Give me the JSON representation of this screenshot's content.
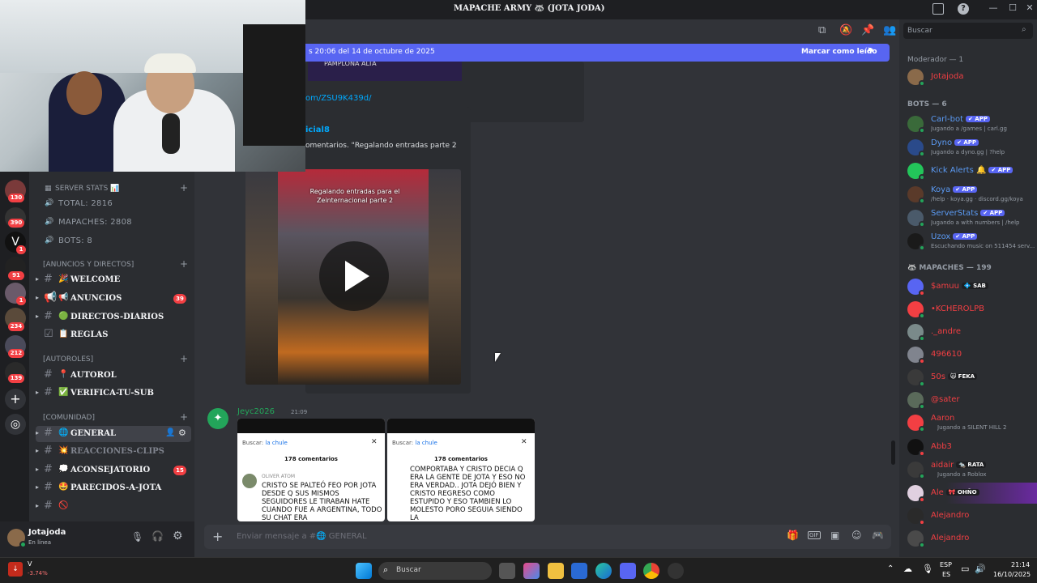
{
  "window": {
    "title": "MAPACHE ARMY 🦝 (JOTA JODA)"
  },
  "banner": {
    "text": "s 20:06 del 14 de octubre de 2025",
    "action": "Marcar como leído"
  },
  "servers": [
    {
      "badge": "130"
    },
    {
      "badge": "390"
    },
    {
      "badge": "1"
    },
    {
      "badge": "91"
    },
    {
      "badge": "1"
    },
    {
      "badge": "234"
    },
    {
      "badge": "212"
    },
    {
      "badge": "139"
    }
  ],
  "sidebar": {
    "stats_category": "SERVER STATS 📊",
    "stats": [
      {
        "icon": "🔊",
        "text": "TOTAL: 2816"
      },
      {
        "icon": "🔊",
        "text": "MAPACHES: 2808"
      },
      {
        "icon": "🔊",
        "text": "BOTS: 8"
      }
    ],
    "cat_announcements": "[ANUNCIOS Y DIRECTOS]",
    "cat_autoroles": "[AUTOROLES]",
    "cat_community": "[COMUNIDAD]",
    "channels": [
      {
        "emoji": "🎉",
        "name": "WELCOME",
        "count": ""
      },
      {
        "emoji": "📢",
        "name": "ANUNCIOS",
        "count": "39"
      },
      {
        "emoji": "🟢",
        "name": "DIRECTOS-DIARIOS",
        "count": ""
      },
      {
        "emoji": "📋",
        "name": "REGLAS",
        "count": ""
      },
      {
        "emoji": "📍",
        "name": "AUTOROL",
        "count": ""
      },
      {
        "emoji": "✅",
        "name": "VERIFICA-TU-SUB",
        "count": ""
      },
      {
        "emoji": "🌐",
        "name": "GENERAL",
        "count": ""
      },
      {
        "emoji": "💥",
        "name": "REACCIONES-CLIPS",
        "count": ""
      },
      {
        "emoji": "💭",
        "name": "ACONSEJATORIO",
        "count": "15"
      },
      {
        "emoji": "🤩",
        "name": "PARECIDOS-A-JOTA",
        "count": ""
      },
      {
        "emoji": "🚫",
        "name": "",
        "count": ""
      }
    ]
  },
  "user": {
    "name": "Jotajoda",
    "status": "En línea"
  },
  "chat": {
    "embed_top_label": "PAMPLONA ALTA",
    "link_fragment": "om/ZSU9K439d/",
    "embed_author": "icial8",
    "embed_desc": "omentarios. \"Regalando entradas parte 2",
    "video_caption": "Regalando entradas para el Zeinternacional parte 2",
    "message_author": "Jeyc2026",
    "message_time": "21:09",
    "shots": [
      {
        "search_label": "Buscar:",
        "search_value": "la chule",
        "comments": "178 comentarios",
        "user": "OLIVER ATOM",
        "text": "CRISTO SE PALTEÓ FEO POR JOTA DESDE Q SUS MISMOS SEGUIDORES LE TIRABAN HATE CUANDO FUE A ARGENTINA, TODO SU CHAT ERA"
      },
      {
        "search_label": "Buscar:",
        "search_value": "la chule",
        "comments": "178 comentarios",
        "user": "",
        "text": "COMPORTABA Y CRISTO DECIA Q ERA LA GENTE DE JOTA Y ESO NO ERA VERDAD.. JOTA DEJÓ BIEN Y CRISTO REGRESO COMO ESTUPIDO Y ESO TAMBIEN LO MOLESTO PORO SEGUIA SIENDO LA"
      }
    ],
    "composer_placeholder": "Enviar mensaje a #🌐 GENERAL"
  },
  "members": {
    "search_placeholder": "Buscar",
    "moderator_header": "Moderador — 1",
    "moderators": [
      {
        "name": "Jotajoda",
        "color": "#f0b232"
      }
    ],
    "bots_header": "BOTS — 6",
    "bots": [
      {
        "name": "Carl-bot",
        "sub": "Jugando a /games | carl.gg",
        "badge": "✔ APP"
      },
      {
        "name": "Dyno",
        "sub": "Jugando a dyno.gg | ?help",
        "badge": "✔ APP"
      },
      {
        "name": "Kick Alerts 🔔",
        "sub": "",
        "badge": "✔ APP"
      },
      {
        "name": "Koya",
        "sub": "/help · koya.gg · discord.gg/koya",
        "badge": "✔ APP"
      },
      {
        "name": "ServerStats",
        "sub": "Jugando a with numbers | /help",
        "badge": "✔ APP"
      },
      {
        "name": "Uzox",
        "sub": "Escuchando music on 511454 serv...",
        "badge": "✔ APP"
      }
    ],
    "mapaches_header": "🦝 MAPACHES — 199",
    "mapaches": [
      {
        "name": "$amuu",
        "sub": "",
        "tag": "💠 SAB"
      },
      {
        "name": "•KCHEROLPB",
        "sub": "",
        "tag": ""
      },
      {
        "name": "._andre",
        "sub": "",
        "tag": ""
      },
      {
        "name": "496610",
        "sub": "",
        "tag": ""
      },
      {
        "name": "50s",
        "sub": "",
        "tag": "🙀 FEKA"
      },
      {
        "name": "@sater",
        "sub": "",
        "tag": ""
      },
      {
        "name": "Aaron",
        "sub": "Jugando a SILENT HILL 2",
        "tag": ""
      },
      {
        "name": "Abb3",
        "sub": "",
        "tag": ""
      },
      {
        "name": "aidair",
        "sub": "Jugando a Roblox",
        "tag": "🐀 RATA"
      },
      {
        "name": "Ale",
        "sub": "",
        "tag": "🎀 OHÑO"
      },
      {
        "name": "Alejandro",
        "sub": "",
        "tag": ""
      },
      {
        "name": "Alejandro",
        "sub": "",
        "tag": ""
      }
    ]
  },
  "taskbar": {
    "stock_label": "V",
    "stock_change": "-3.74%",
    "search_placeholder": "Buscar",
    "lang_top": "ESP",
    "lang_bottom": "ES",
    "time": "21:14",
    "date": "16/10/2025"
  },
  "colors": {
    "accent": "#5865f2",
    "danger": "#f23f43",
    "online": "#23a55a",
    "member_red": "#f23f43"
  }
}
